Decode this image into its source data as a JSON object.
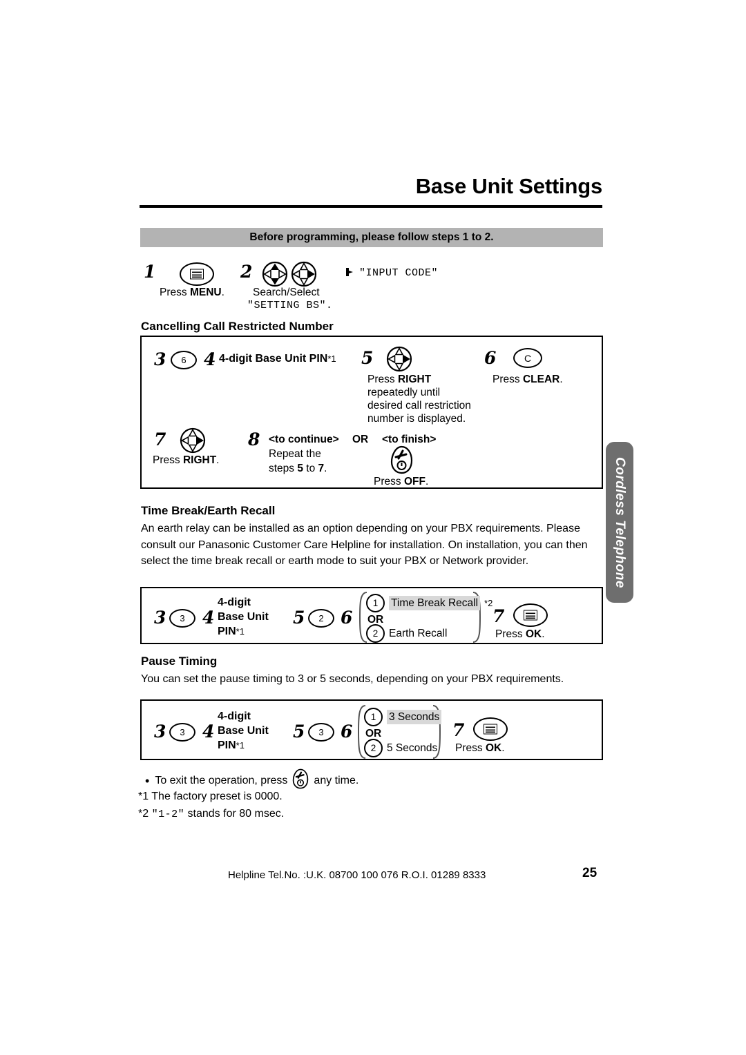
{
  "document": {
    "title": "Base Unit Settings",
    "side_tab": "Cordless Telephone",
    "banner": "Before programming, please follow steps 1 to 2."
  },
  "intro_steps": {
    "step1": {
      "number": "1",
      "icon": "menu-key-icon",
      "caption_plain": "Press ",
      "caption_bold": "MENU",
      "caption_tail": "."
    },
    "step2": {
      "number": "2",
      "icon_a": "nav-updown-icon",
      "icon_b": "nav-right-icon",
      "caption_line1": "Search/Select",
      "caption_line2": "\"SETTING BS\"."
    },
    "display": {
      "arrow_icon": "arrow-marker-icon",
      "text": "\"INPUT CODE\""
    }
  },
  "sections": [
    {
      "heading": "Cancelling Call Restricted Number",
      "steps": {
        "s3_num": "3",
        "s3_key": "6",
        "s4_num": "4",
        "s4_text_bold": "4-digit Base Unit PIN",
        "s4_text_note": "*1",
        "s5_num": "5",
        "s5_icon": "nav-right-icon",
        "s5_line1_plain": "Press ",
        "s5_line1_bold": "RIGHT",
        "s5_line2": "repeatedly until",
        "s5_line3": "desired call restriction",
        "s5_line4": "number is displayed.",
        "s6_num": "6",
        "s6_key": "C",
        "s6_caption_plain": "Press ",
        "s6_caption_bold": "CLEAR",
        "s6_caption_tail": ".",
        "s7_num": "7",
        "s7_icon": "nav-right-icon",
        "s7_caption_plain": "Press ",
        "s7_caption_bold": "RIGHT",
        "s7_caption_tail": ".",
        "s8_num": "8",
        "s8_continue_label": "<to continue>",
        "s8_or": "OR",
        "s8_finish_label": "<to finish>",
        "s8_repeat_line1": "Repeat the",
        "s8_repeat_line2_a": "steps ",
        "s8_repeat_line2_b": "5",
        "s8_repeat_line2_c": " to ",
        "s8_repeat_line2_d": "7",
        "s8_repeat_line2_e": ".",
        "s8_off_icon": "off-key-icon",
        "s8_off_plain": "Press ",
        "s8_off_bold": "OFF",
        "s8_off_tail": "."
      }
    },
    {
      "heading": "Time Break/Earth Recall",
      "body": "An earth relay can be installed as an option depending on your PBX requirements. Please consult our Panasonic Customer Care Helpline for installation. On installation, you can then select the time break recall or earth mode to suit your PBX or Network provider.",
      "steps": {
        "s3_num": "3",
        "s3_key": "3",
        "s4_num": "4",
        "pin_line1": "4-digit",
        "pin_line2": "Base Unit",
        "pin_line3_bold": "PIN",
        "pin_line3_note": "*1",
        "s5_num": "5",
        "s5_key": "2",
        "s6_num": "6",
        "opt1_num": "1",
        "opt1_label": "Time Break Recall",
        "opt1_note": "*2",
        "opt_or": "OR",
        "opt2_num": "2",
        "opt2_label": "Earth Recall",
        "s7_num": "7",
        "s7_icon": "ok-key-icon",
        "s7_caption_plain": "Press ",
        "s7_caption_bold": "OK",
        "s7_caption_tail": "."
      }
    },
    {
      "heading": "Pause Timing",
      "body": "You can set the pause timing to 3 or 5 seconds, depending on your PBX requirements.",
      "steps": {
        "s3_num": "3",
        "s3_key": "3",
        "s4_num": "4",
        "pin_line1": "4-digit",
        "pin_line2": "Base Unit",
        "pin_line3_bold": "PIN",
        "pin_line3_note": "*1",
        "s5_num": "5",
        "s5_key": "3",
        "s6_num": "6",
        "opt1_num": "1",
        "opt1_label": "3 Seconds",
        "opt_or": "OR",
        "opt2_num": "2",
        "opt2_label": "5 Seconds",
        "s7_num": "7",
        "s7_icon": "ok-key-icon",
        "s7_caption_plain": "Press ",
        "s7_caption_bold": "OK",
        "s7_caption_tail": "."
      }
    }
  ],
  "notes": {
    "bullet_prefix": "To exit the operation, press",
    "bullet_icon": "off-key-icon",
    "bullet_suffix": "any time.",
    "note1": "*1 The factory preset is 0000.",
    "note2_prefix": "*2 ",
    "note2_mono": "\"1-2\"",
    "note2_suffix": " stands for 80 msec."
  },
  "footer": {
    "helpline": "Helpline Tel.No. :U.K. 08700 100 076  R.O.I. 01289 8333",
    "page_number": "25"
  },
  "colors": {
    "banner_gray": "#b3b3b3",
    "tab_gray": "#6e6e6e",
    "highlight_gray": "#d8d8d8"
  }
}
